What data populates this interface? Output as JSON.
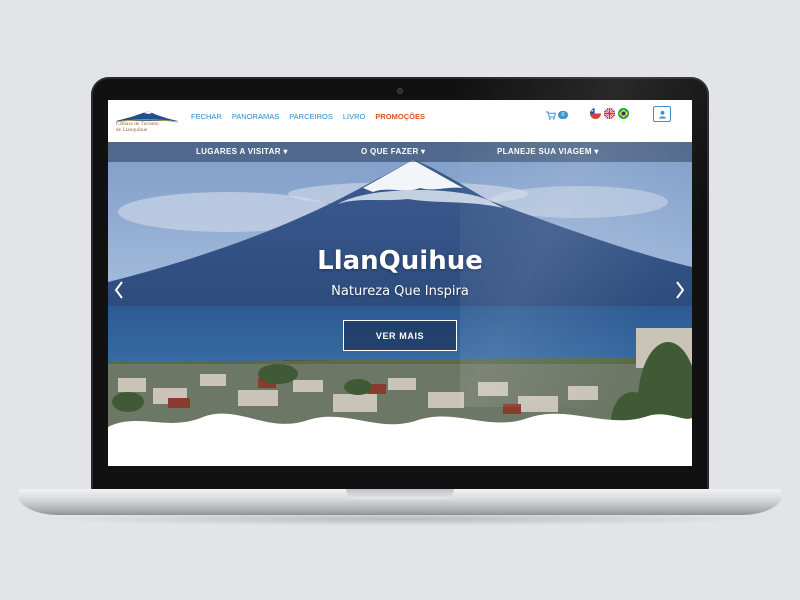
{
  "logo": {
    "line1": "Camara de Turismo",
    "line2": "de Llanquihue"
  },
  "nav": {
    "items": [
      {
        "label": "FECHAR"
      },
      {
        "label": "PANORAMAS"
      },
      {
        "label": "PARCEIROS"
      },
      {
        "label": "LIVRO"
      },
      {
        "label": "PROMOÇÕES",
        "highlight": true
      }
    ]
  },
  "cart": {
    "icon": "cart-icon",
    "count": "0"
  },
  "languages": [
    {
      "icon": "flag-chile-icon"
    },
    {
      "icon": "flag-uk-icon"
    },
    {
      "icon": "flag-brazil-icon"
    }
  ],
  "user": {
    "icon": "user-icon"
  },
  "subnav": {
    "items": [
      {
        "label": "LUGARES A VISITAR ▾"
      },
      {
        "label": "O QUE FAZER ▾"
      },
      {
        "label": "PLANEJE SUA VIAGEM ▾"
      }
    ]
  },
  "hero": {
    "title": "LlanQuihue",
    "subtitle": "Natureza Que Inspira",
    "cta_label": "VER MAIS"
  },
  "colors": {
    "link": "#2d8bc9",
    "promo": "#d9531e",
    "lake": "#2f5f95",
    "sky": "#93aed3"
  }
}
